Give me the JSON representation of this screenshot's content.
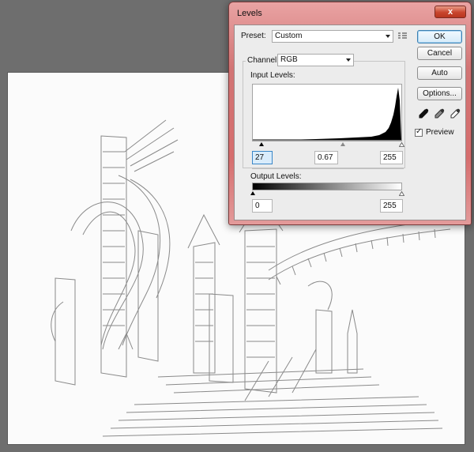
{
  "window": {
    "title": "Levels",
    "close_glyph": "x"
  },
  "preset": {
    "label": "Preset:",
    "value": "Custom",
    "menu_icon": "preset-options-icon"
  },
  "channel": {
    "label": "Channel:",
    "value": "RGB"
  },
  "input_levels": {
    "label": "Input Levels:",
    "black": "27",
    "gamma": "0.67",
    "white": "255"
  },
  "output_levels": {
    "label": "Output Levels:",
    "black": "0",
    "white": "255"
  },
  "buttons": {
    "ok": "OK",
    "cancel": "Cancel",
    "auto": "Auto",
    "options": "Options..."
  },
  "preview": {
    "label": "Preview",
    "checked": true
  },
  "eyedroppers": [
    "black-eyedropper-icon",
    "gray-eyedropper-icon",
    "white-eyedropper-icon"
  ],
  "colors": {
    "title_bar": "#d66e6e",
    "canvas_bg": "#6e6e6e",
    "dialog_bg": "#ececec"
  }
}
